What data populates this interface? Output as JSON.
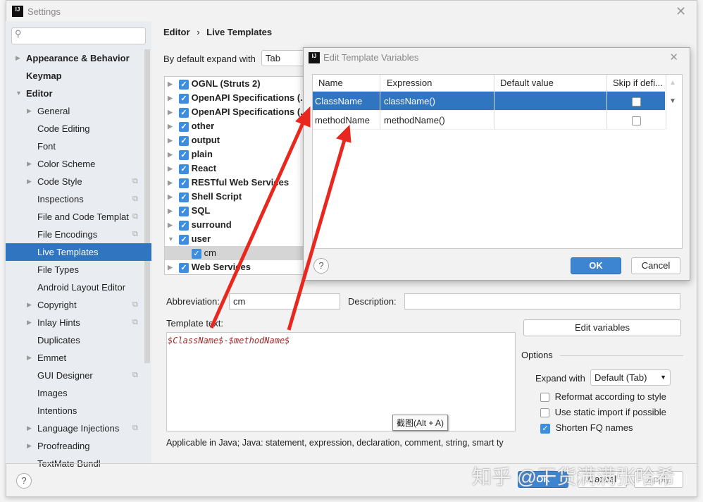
{
  "window": {
    "title": "Settings"
  },
  "breadcrumb": {
    "parent": "Editor",
    "sep": "›",
    "current": "Live Templates"
  },
  "sidebar": {
    "items": [
      {
        "label": "Appearance & Behavior",
        "level": 0,
        "bold": true,
        "arrow": "right"
      },
      {
        "label": "Keymap",
        "level": 0,
        "bold": true
      },
      {
        "label": "Editor",
        "level": 0,
        "bold": true,
        "arrow": "down"
      },
      {
        "label": "General",
        "level": 1,
        "arrow": "right"
      },
      {
        "label": "Code Editing",
        "level": 1
      },
      {
        "label": "Font",
        "level": 1
      },
      {
        "label": "Color Scheme",
        "level": 1,
        "arrow": "right"
      },
      {
        "label": "Code Style",
        "level": 1,
        "arrow": "right",
        "copy": true
      },
      {
        "label": "Inspections",
        "level": 1,
        "copy": true
      },
      {
        "label": "File and Code Templat",
        "level": 1,
        "copy": true
      },
      {
        "label": "File Encodings",
        "level": 1,
        "copy": true
      },
      {
        "label": "Live Templates",
        "level": 1,
        "selected": true
      },
      {
        "label": "File Types",
        "level": 1
      },
      {
        "label": "Android Layout Editor",
        "level": 1
      },
      {
        "label": "Copyright",
        "level": 1,
        "arrow": "right",
        "copy": true
      },
      {
        "label": "Inlay Hints",
        "level": 1,
        "arrow": "right",
        "copy": true
      },
      {
        "label": "Duplicates",
        "level": 1
      },
      {
        "label": "Emmet",
        "level": 1,
        "arrow": "right"
      },
      {
        "label": "GUI Designer",
        "level": 1,
        "copy": true
      },
      {
        "label": "Images",
        "level": 1
      },
      {
        "label": "Intentions",
        "level": 1
      },
      {
        "label": "Language Injections",
        "level": 1,
        "arrow": "right",
        "copy": true
      },
      {
        "label": "Proofreading",
        "level": 1,
        "arrow": "right"
      },
      {
        "label": "TextMate Bundl",
        "level": 1
      }
    ]
  },
  "expand": {
    "label": "By default expand with",
    "value": "Tab"
  },
  "tree": [
    {
      "label": "OGNL (Struts 2)"
    },
    {
      "label": "OpenAPI Specifications (."
    },
    {
      "label": "OpenAPI Specifications (."
    },
    {
      "label": "other"
    },
    {
      "label": "output"
    },
    {
      "label": "plain"
    },
    {
      "label": "React"
    },
    {
      "label": "RESTful Web Services"
    },
    {
      "label": "Shell Script"
    },
    {
      "label": "SQL"
    },
    {
      "label": "surround"
    },
    {
      "label": "user",
      "expanded": true
    },
    {
      "label": "cm",
      "child": true
    },
    {
      "label": "Web Services"
    }
  ],
  "form": {
    "abbreviation_label": "Abbreviation:",
    "abbreviation": "cm",
    "description_label": "Description:",
    "description": "",
    "template_label": "Template text:",
    "template": "$ClassName$-$methodName$",
    "edit_variables": "Edit variables",
    "applicable": "Applicable in Java; Java: statement, expression, declaration, comment, string, smart ty"
  },
  "options": {
    "title": "Options",
    "expand_label": "Expand with",
    "expand_value": "Default (Tab)",
    "checks": [
      {
        "label": "Reformat according to style",
        "checked": false
      },
      {
        "label": "Use static import if possible",
        "checked": false
      },
      {
        "label": "Shorten FQ names",
        "checked": true
      }
    ]
  },
  "tooltip": "截图(Alt + A)",
  "dialog": {
    "title": "Edit Template Variables",
    "columns": [
      "Name",
      "Expression",
      "Default value",
      "Skip if defi..."
    ],
    "rows": [
      {
        "name": "ClassName",
        "expression": "className()",
        "default": "",
        "skip": false,
        "selected": true
      },
      {
        "name": "methodName",
        "expression": "methodName()",
        "default": "",
        "skip": false
      }
    ],
    "ok": "OK",
    "cancel": "Cancel",
    "help": "?"
  },
  "footer": {
    "help": "?",
    "ok": "OK",
    "cancel": "Cancel",
    "apply": "Apply"
  },
  "watermark": "知乎 @干货满满张哈希",
  "colors": {
    "accent": "#2f75c0",
    "annotation_arrow": "#e8281e",
    "template_text": "#9b2a2a"
  }
}
